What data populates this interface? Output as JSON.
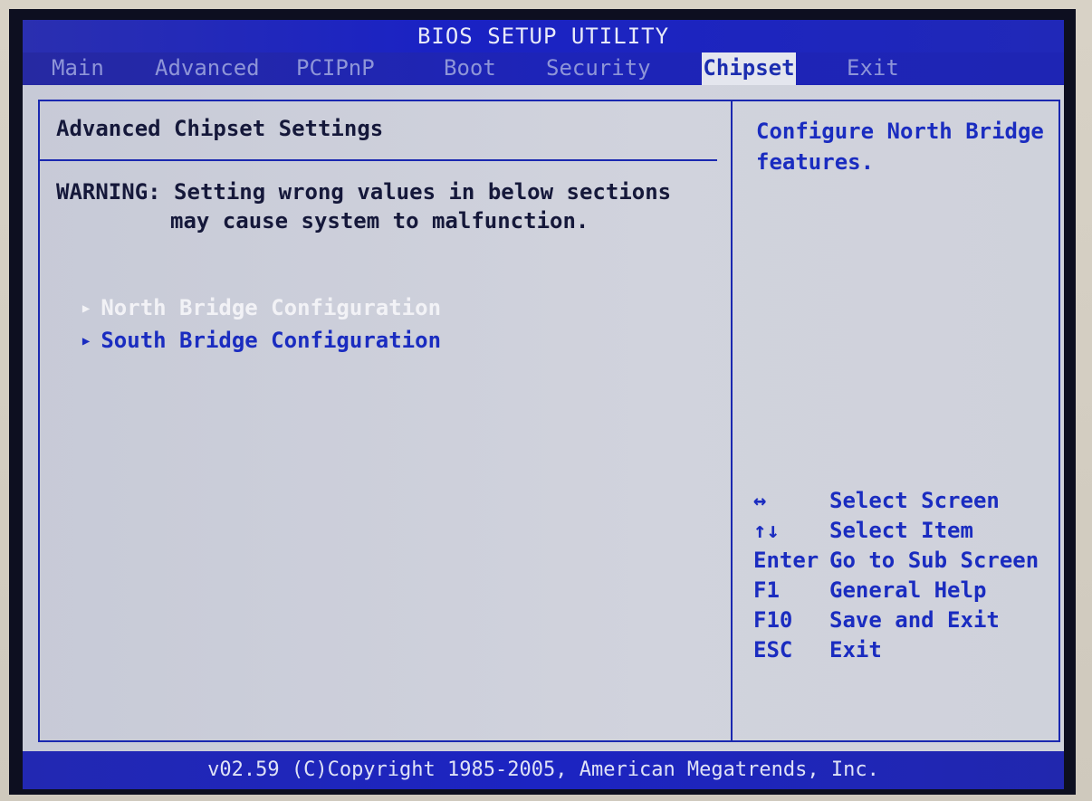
{
  "title": "BIOS SETUP UTILITY",
  "tabs": [
    {
      "label": "Main"
    },
    {
      "label": "Advanced"
    },
    {
      "label": "PCIPnP"
    },
    {
      "label": "Boot"
    },
    {
      "label": "Security"
    },
    {
      "label": "Chipset"
    },
    {
      "label": "Exit"
    }
  ],
  "active_tab": "Chipset",
  "panel": {
    "title": "Advanced Chipset Settings",
    "warning_line1": "WARNING: Setting wrong values in below sections",
    "warning_line2": "may cause system to malfunction.",
    "items": [
      {
        "label": "North Bridge Configuration",
        "selected": true
      },
      {
        "label": "South Bridge Configuration",
        "selected": false
      }
    ]
  },
  "help": {
    "text": "Configure North Bridge features.",
    "keys": [
      {
        "key": "↔",
        "action": "Select Screen"
      },
      {
        "key": "↑↓",
        "action": "Select Item"
      },
      {
        "key": "Enter",
        "action": "Go to Sub Screen"
      },
      {
        "key": "F1",
        "action": "General Help"
      },
      {
        "key": "F10",
        "action": "Save and Exit"
      },
      {
        "key": "ESC",
        "action": "Exit"
      }
    ]
  },
  "footer": "v02.59 (C)Copyright 1985-2005, American Megatrends, Inc.",
  "colors": {
    "blue_bar": "#1d24b8",
    "text_blue": "#1a2cc0",
    "panel_bg": "#cfd2db",
    "selected_item": "#f2f2f6"
  }
}
